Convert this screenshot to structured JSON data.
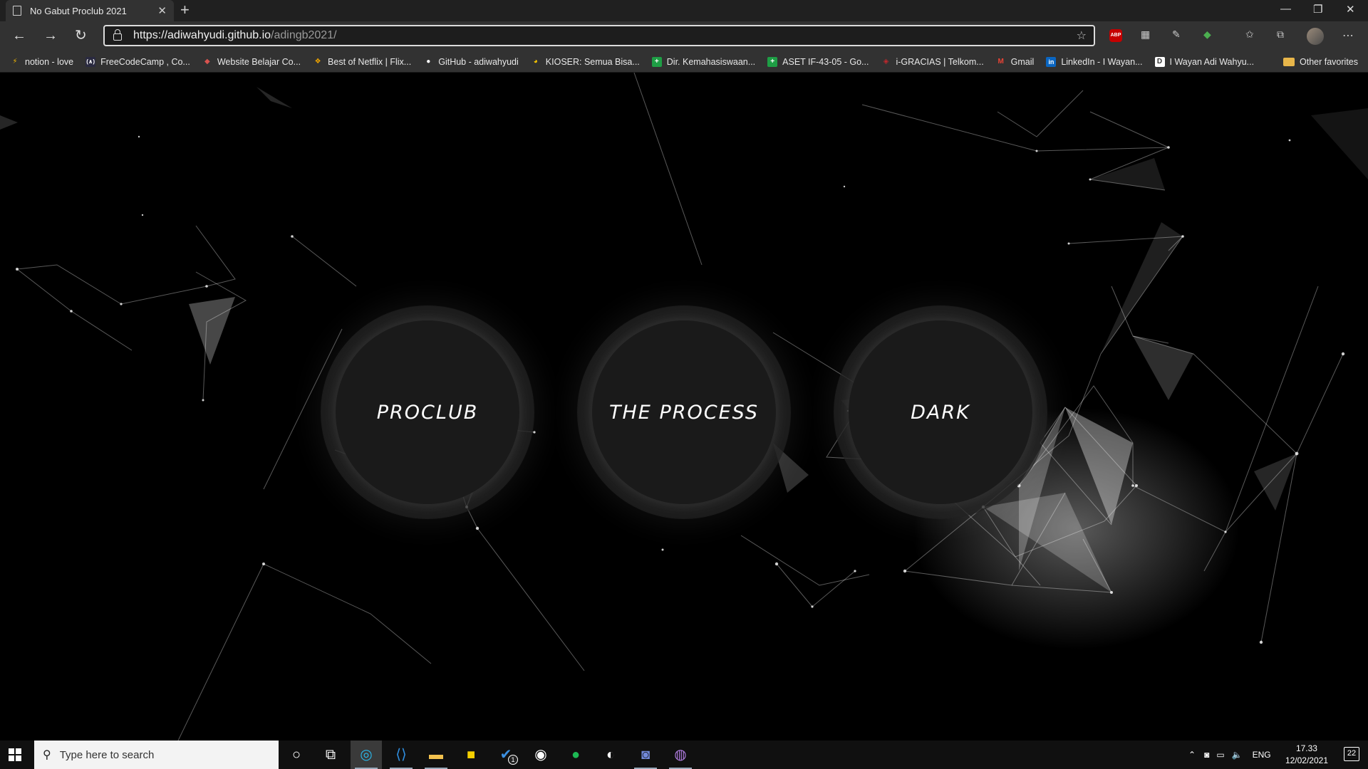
{
  "browser": {
    "tab_title": "No Gabut Proclub 2021",
    "tab_close": "✕",
    "new_tab": "+",
    "url_host": "https://adiwahyudi.github.io",
    "url_path": "/adingb2021/",
    "window_controls": {
      "minimize": "—",
      "restore": "❐",
      "close": "✕"
    }
  },
  "bookmarks": [
    {
      "label": "notion - love",
      "icon_color": "#f5b800",
      "glyph": "⚡"
    },
    {
      "label": "FreeCodeCamp , Co...",
      "icon_color": "#2a2a40",
      "glyph": "(∧)"
    },
    {
      "label": "Website Belajar Co...",
      "icon_color": "#d9534f",
      "glyph": "◆"
    },
    {
      "label": "Best of Netflix | Flix...",
      "icon_color": "#f0a500",
      "glyph": "❖"
    },
    {
      "label": "GitHub - adiwahyudi",
      "icon_color": "#ffffff",
      "glyph": "●"
    },
    {
      "label": "KIOSER: Semua Bisa...",
      "icon_color": "#f5c400",
      "glyph": "◕"
    },
    {
      "label": "Dir. Kemahasiswaan...",
      "icon_color": "#1e9e45",
      "glyph": "+"
    },
    {
      "label": "ASET IF-43-05 - Go...",
      "icon_color": "#1e9e45",
      "glyph": "+"
    },
    {
      "label": "i-GRACIAS | Telkom...",
      "icon_color": "#c0282d",
      "glyph": "◈"
    },
    {
      "label": "Gmail",
      "icon_color": "#ea4335",
      "glyph": "M"
    },
    {
      "label": "LinkedIn - I Wayan...",
      "icon_color": "#0a66c2",
      "glyph": "in"
    },
    {
      "label": "I Wayan Adi Wahyu...",
      "icon_color": "#ffffff",
      "glyph": "D"
    }
  ],
  "other_favorites": "Other favorites",
  "page": {
    "circles": [
      "PROCLUB",
      "THE PROCESS",
      "DARK"
    ]
  },
  "taskbar": {
    "search_placeholder": "Type here to search",
    "language": "ENG",
    "time": "17.33",
    "date": "12/02/2021",
    "notifications": "22",
    "badge_count": "1"
  }
}
